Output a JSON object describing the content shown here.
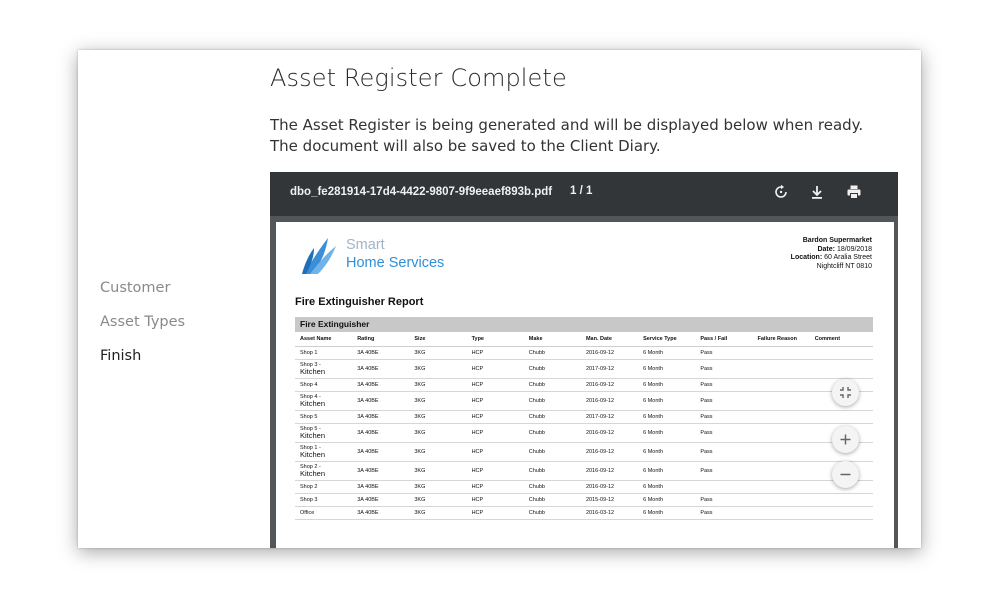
{
  "steps": [
    "Customer",
    "Asset Types",
    "Finish"
  ],
  "main": {
    "title": "Asset Register Complete",
    "description": "The Asset Register is being generated and will be displayed below when ready. The document will also be saved to the Client Diary."
  },
  "viewer": {
    "filename": "dbo_fe281914-17d4-4422-9807-9f9eeaef893b.pdf",
    "pages": "1  /  1",
    "icons": [
      "rotate-icon",
      "download-icon",
      "print-icon"
    ]
  },
  "pdf": {
    "logo": {
      "line1": "Smart",
      "line2": "Home Services"
    },
    "customer": {
      "name": "Bardon Supermarket",
      "date_label": "Date:",
      "date": "18/09/2018",
      "location_label": "Location:",
      "location_line1": "60 Aralia Street",
      "location_line2": "Nightcliff NT 0810"
    },
    "report_title": "Fire Extinguisher Report",
    "section": "Fire Extinguisher",
    "columns": [
      "Asset Name",
      "Rating",
      "Size",
      "Type",
      "Make",
      "Man. Date",
      "Service Type",
      "Pass / Fail",
      "Failure Reason",
      "Comment"
    ],
    "rows": [
      {
        "name1": "Shop 1",
        "name2": "",
        "rating": "3A 40BE",
        "size": "3KG",
        "type": "HCP",
        "make": "Chubb",
        "date": "2016-09-12",
        "service": "6 Month",
        "pass": "Pass",
        "reason": "",
        "comment": ""
      },
      {
        "name1": "Shop 3 -",
        "name2": "Kitchen",
        "rating": "3A 40BE",
        "size": "3KG",
        "type": "HCP",
        "make": "Chubb",
        "date": "2017-09-12",
        "service": "6 Month",
        "pass": "Pass",
        "reason": "",
        "comment": ""
      },
      {
        "name1": "Shop 4",
        "name2": "",
        "rating": "3A 40BE",
        "size": "3KG",
        "type": "HCP",
        "make": "Chubb",
        "date": "2016-09-12",
        "service": "6 Month",
        "pass": "Pass",
        "reason": "",
        "comment": ""
      },
      {
        "name1": "Shop 4 -",
        "name2": "Kitchen",
        "rating": "3A 40BE",
        "size": "3KG",
        "type": "HCP",
        "make": "Chubb",
        "date": "2016-09-12",
        "service": "6 Month",
        "pass": "Pass",
        "reason": "",
        "comment": ""
      },
      {
        "name1": "Shop 5",
        "name2": "",
        "rating": "3A 40BE",
        "size": "3KG",
        "type": "HCP",
        "make": "Chubb",
        "date": "2017-09-12",
        "service": "6 Month",
        "pass": "Pass",
        "reason": "",
        "comment": ""
      },
      {
        "name1": "Shop 5 -",
        "name2": "Kitchen",
        "rating": "3A 40BE",
        "size": "3KG",
        "type": "HCP",
        "make": "Chubb",
        "date": "2016-09-12",
        "service": "6 Month",
        "pass": "Pass",
        "reason": "",
        "comment": ""
      },
      {
        "name1": "Shop 1 -",
        "name2": "Kitchen",
        "rating": "3A 40BE",
        "size": "3KG",
        "type": "HCP",
        "make": "Chubb",
        "date": "2016-09-12",
        "service": "6 Month",
        "pass": "Pass",
        "reason": "",
        "comment": ""
      },
      {
        "name1": "Shop 2 -",
        "name2": "Kitchen",
        "rating": "3A 40BE",
        "size": "3KG",
        "type": "HCP",
        "make": "Chubb",
        "date": "2016-09-12",
        "service": "6 Month",
        "pass": "Pass",
        "reason": "",
        "comment": ""
      },
      {
        "name1": "Shop 2",
        "name2": "",
        "rating": "3A 40BE",
        "size": "3KG",
        "type": "HCP",
        "make": "Chubb",
        "date": "2016-09-12",
        "service": "6 Month",
        "pass": "",
        "reason": "",
        "comment": ""
      },
      {
        "name1": "Shop 3",
        "name2": "",
        "rating": "3A 40BE",
        "size": "3KG",
        "type": "HCP",
        "make": "Chubb",
        "date": "2015-09-12",
        "service": "6 Month",
        "pass": "Pass",
        "reason": "",
        "comment": ""
      },
      {
        "name1": "Office",
        "name2": "",
        "rating": "3A 40BE",
        "size": "3KG",
        "type": "HCP",
        "make": "Chubb",
        "date": "2016-03-12",
        "service": "6 Month",
        "pass": "Pass",
        "reason": "",
        "comment": ""
      }
    ]
  },
  "controls": [
    "fit-icon",
    "zoom-in-icon",
    "zoom-out-icon"
  ]
}
